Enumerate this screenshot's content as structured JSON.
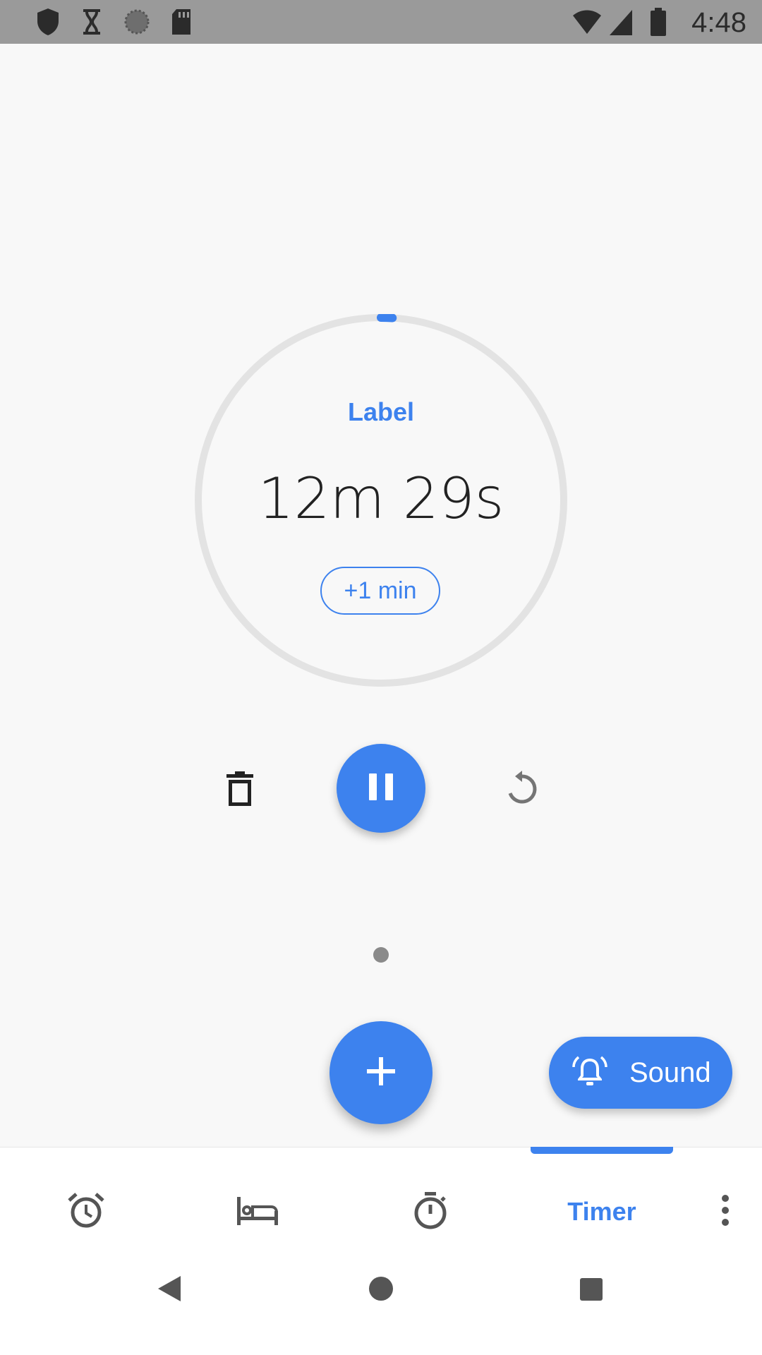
{
  "status_bar": {
    "time": "4:48",
    "left_icons": [
      "shield-icon",
      "hourglass-icon",
      "sync-icon",
      "sd-card-icon"
    ],
    "right_icons": [
      "wifi-icon",
      "signal-icon",
      "battery-icon"
    ]
  },
  "timer": {
    "label": "Label",
    "remaining": "12m 29s",
    "add_minute_label": "+1 min",
    "progress_fraction": 0.01
  },
  "controls": {
    "delete_icon": "delete-icon",
    "pause_icon": "pause-icon",
    "reset_icon": "reset-icon"
  },
  "fab": {
    "icon": "plus-icon"
  },
  "sound_button": {
    "label": "Sound",
    "icon": "alarm-bell-icon"
  },
  "bottom_nav": {
    "tabs": [
      {
        "name": "alarm",
        "icon": "alarm-clock-icon"
      },
      {
        "name": "bedtime",
        "icon": "bed-icon"
      },
      {
        "name": "stopwatch",
        "icon": "stopwatch-icon"
      },
      {
        "name": "timer",
        "label": "Timer",
        "active": true
      }
    ],
    "more_icon": "more-vert-icon"
  },
  "system_nav": [
    "back-icon",
    "home-icon",
    "recents-icon"
  ],
  "colors": {
    "accent": "#3d82ee",
    "ring": "#e3e3e3",
    "background": "#f8f8f8"
  }
}
